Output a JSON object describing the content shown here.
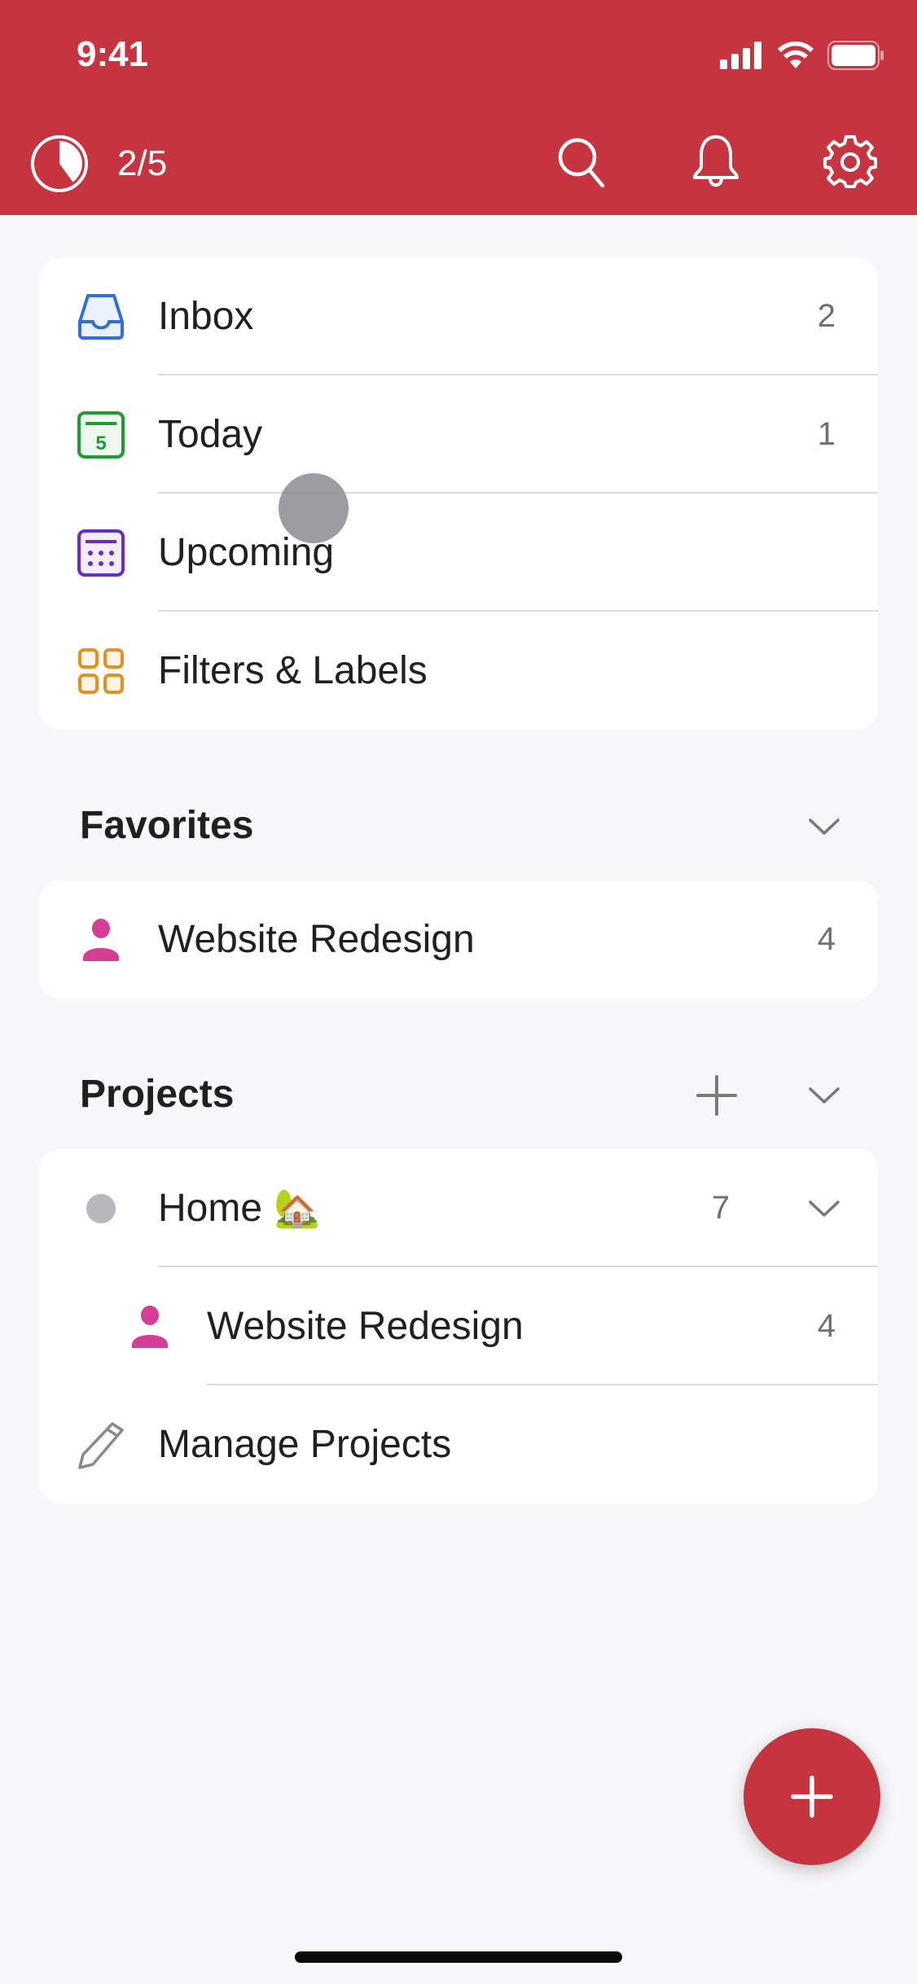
{
  "status_bar": {
    "time": "9:41"
  },
  "toolbar": {
    "progress_text": "2/5",
    "progress_value": 0.4,
    "icons": [
      "search-icon",
      "bell-icon",
      "gear-icon"
    ]
  },
  "colors": {
    "brand": "#C63440",
    "inbox": "#2F6FDB",
    "today": "#1E9B35",
    "upcoming": "#6A2BC6",
    "filters": "#E3901C",
    "project_pink": "#D63E96",
    "home_dot": "#B8B8BC"
  },
  "main_nav": [
    {
      "label": "Inbox",
      "count": "2",
      "icon": "inbox-tray-icon"
    },
    {
      "label": "Today",
      "count": "1",
      "icon": "calendar-today-icon",
      "icon_text": "5"
    },
    {
      "label": "Upcoming",
      "count": "",
      "icon": "calendar-upcoming-icon"
    },
    {
      "label": "Filters & Labels",
      "count": "",
      "icon": "grid-icon"
    }
  ],
  "favorites": {
    "title": "Favorites",
    "items": [
      {
        "label": "Website Redesign",
        "count": "4",
        "icon": "person-icon"
      }
    ]
  },
  "projects": {
    "title": "Projects",
    "items": [
      {
        "label": "Home",
        "emoji": "🏡",
        "count": "7",
        "icon": "dot-icon"
      },
      {
        "label": "Website Redesign",
        "count": "4",
        "icon": "person-icon"
      }
    ],
    "manage_label": "Manage Projects"
  },
  "fab": {
    "icon": "plus-icon"
  }
}
